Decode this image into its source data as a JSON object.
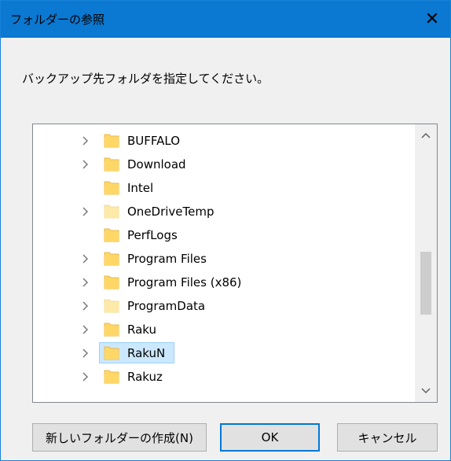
{
  "window": {
    "title": "フォルダーの参照",
    "close_glyph": "✕"
  },
  "instruction": "バックアップ先フォルダを指定してください。",
  "tree": {
    "items": [
      {
        "label": "BUFFALO",
        "has_children": true,
        "selected": false,
        "faded": false
      },
      {
        "label": "Download",
        "has_children": true,
        "selected": false,
        "faded": false
      },
      {
        "label": "Intel",
        "has_children": false,
        "selected": false,
        "faded": false
      },
      {
        "label": "OneDriveTemp",
        "has_children": true,
        "selected": false,
        "faded": true
      },
      {
        "label": "PerfLogs",
        "has_children": false,
        "selected": false,
        "faded": false
      },
      {
        "label": "Program Files",
        "has_children": true,
        "selected": false,
        "faded": false
      },
      {
        "label": "Program Files (x86)",
        "has_children": true,
        "selected": false,
        "faded": false
      },
      {
        "label": "ProgramData",
        "has_children": true,
        "selected": false,
        "faded": true
      },
      {
        "label": "Raku",
        "has_children": true,
        "selected": false,
        "faded": false
      },
      {
        "label": "RakuN",
        "has_children": true,
        "selected": true,
        "faded": false
      },
      {
        "label": "Rakuz",
        "has_children": true,
        "selected": false,
        "faded": false
      }
    ]
  },
  "buttons": {
    "new_folder": "新しいフォルダーの作成(N)",
    "ok": "OK",
    "cancel": "キャンセル"
  },
  "colors": {
    "titlebar": "#0b78d1",
    "selection_fill": "#cce8ff",
    "selection_border": "#99d1ff",
    "folder": "#ffd766",
    "folder_faded": "#fde9a8",
    "ok_border": "#0078d7"
  },
  "icons": {
    "folder": "folder-icon",
    "expand": "chevron-right-icon",
    "scroll_up": "scroll-up-arrow-icon",
    "scroll_down": "scroll-down-arrow-icon",
    "close": "close-icon"
  }
}
